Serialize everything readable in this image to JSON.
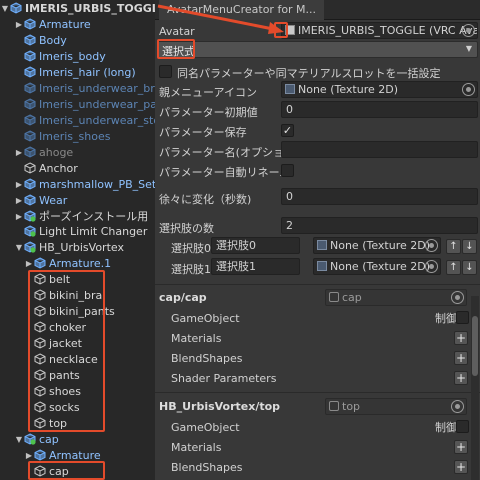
{
  "hierarchy": {
    "items": [
      {
        "label": "IMERIS_URBIS_TOGGLE",
        "style": "root",
        "arrow": "▼",
        "icon": "prefab",
        "indent": 0
      },
      {
        "label": "Armature",
        "style": "pf",
        "arrow": "▶",
        "icon": "prefab",
        "indent": 1
      },
      {
        "label": "Body",
        "style": "pf",
        "arrow": "",
        "icon": "prefab",
        "indent": 1
      },
      {
        "label": "Imeris_body",
        "style": "pf",
        "arrow": "",
        "icon": "prefab",
        "indent": 1
      },
      {
        "label": "Imeris_hair (long)",
        "style": "pf",
        "arrow": "",
        "icon": "prefab",
        "indent": 1
      },
      {
        "label": "Imeris_underwear_bra",
        "style": "pfdim",
        "arrow": "",
        "icon": "prefab-dim",
        "indent": 1
      },
      {
        "label": "Imeris_underwear_panty",
        "style": "pfdim",
        "arrow": "",
        "icon": "prefab-dim",
        "indent": 1
      },
      {
        "label": "Imeris_underwear_stocking",
        "style": "pfdim",
        "arrow": "",
        "icon": "prefab-dim",
        "indent": 1
      },
      {
        "label": "Imeris_shoes",
        "style": "pfdim",
        "arrow": "",
        "icon": "prefab-dim",
        "indent": 1
      },
      {
        "label": "ahoge",
        "style": "dim",
        "arrow": "▶",
        "icon": "prefab-dim",
        "indent": 1
      },
      {
        "label": "Anchor",
        "style": "plain",
        "arrow": "",
        "icon": "object",
        "indent": 1
      },
      {
        "label": "marshmallow_PB_Setup",
        "style": "pf",
        "arrow": "▶",
        "icon": "prefab",
        "indent": 1
      },
      {
        "label": "Wear",
        "style": "pf",
        "arrow": "▶",
        "icon": "prefab",
        "indent": 1
      },
      {
        "label": "ポーズインストール用",
        "style": "plain",
        "arrow": "▶",
        "icon": "prefab-green",
        "indent": 1
      },
      {
        "label": "Light Limit Changer",
        "style": "plain",
        "arrow": "",
        "icon": "prefab-green",
        "indent": 1
      },
      {
        "label": "HB_UrbisVortex",
        "style": "plain",
        "arrow": "▼",
        "icon": "prefab-green",
        "indent": 1
      },
      {
        "label": "Armature.1",
        "style": "pf",
        "arrow": "▶",
        "icon": "prefab",
        "indent": 2
      },
      {
        "label": "belt",
        "style": "plain",
        "arrow": "",
        "icon": "object",
        "indent": 2
      },
      {
        "label": "bikini_bra",
        "style": "plain",
        "arrow": "",
        "icon": "object",
        "indent": 2
      },
      {
        "label": "bikini_pants",
        "style": "plain",
        "arrow": "",
        "icon": "object",
        "indent": 2
      },
      {
        "label": "choker",
        "style": "plain",
        "arrow": "",
        "icon": "object",
        "indent": 2
      },
      {
        "label": "jacket",
        "style": "plain",
        "arrow": "",
        "icon": "object",
        "indent": 2
      },
      {
        "label": "necklace",
        "style": "plain",
        "arrow": "",
        "icon": "object",
        "indent": 2
      },
      {
        "label": "pants",
        "style": "plain",
        "arrow": "",
        "icon": "object",
        "indent": 2
      },
      {
        "label": "shoes",
        "style": "plain",
        "arrow": "",
        "icon": "object",
        "indent": 2
      },
      {
        "label": "socks",
        "style": "plain",
        "arrow": "",
        "icon": "object",
        "indent": 2
      },
      {
        "label": "top",
        "style": "plain",
        "arrow": "",
        "icon": "object",
        "indent": 2
      },
      {
        "label": "cap",
        "style": "pf",
        "arrow": "▼",
        "icon": "prefab-green",
        "indent": 1
      },
      {
        "label": "Armature",
        "style": "pf",
        "arrow": "▶",
        "icon": "prefab",
        "indent": 2
      },
      {
        "label": "cap",
        "style": "plain",
        "arrow": "",
        "icon": "object",
        "indent": 2
      }
    ]
  },
  "inspector": {
    "tab_title": "AvatarMenuCreator for M...",
    "avatar_label": "Avatar",
    "avatar_value": "IMERIS_URBIS_TOGGLE (VRC Avatar D",
    "menu_type": "選択式",
    "sync_checkbox_label": "同名パラメーターや同マテリアルスロットを一括設定",
    "parent_menu_icon_label": "親メニューアイコン",
    "parent_menu_icon_value": "None (Texture 2D)",
    "param_default_label": "パラメーター初期値",
    "param_default_value": "0",
    "param_saved_label": "パラメーター保存",
    "param_saved_check": "✓",
    "param_name_label": "パラメーター名(オプショナル)",
    "param_autorename_label": "パラメーター自動リネーム",
    "gradual_label": "徐々に変化（秒数)",
    "gradual_value": "0",
    "choice_count_label": "選択肢の数",
    "choice_count_value": "2",
    "choices": [
      {
        "label": "選択肢0",
        "value": "選択肢0",
        "icon": "None (Texture 2D)"
      },
      {
        "label": "選択肢1",
        "value": "選択肢1",
        "icon": "None (Texture 2D)"
      }
    ],
    "sections": [
      {
        "title": "cap/cap",
        "ref": "cap",
        "rows": [
          "GameObject",
          "Materials",
          "BlendShapes",
          "Shader Parameters"
        ],
        "control_label": "制御"
      },
      {
        "title": "HB_UrbisVortex/top",
        "ref": "top",
        "rows": [
          "GameObject",
          "Materials",
          "BlendShapes"
        ],
        "control_label": "制御"
      }
    ],
    "plus": "+",
    "up": "↑",
    "down": "↓"
  },
  "colors": {
    "highlight": "#e34b2b",
    "prefab_blue": "#8fc2ff",
    "panel_bg": "#383838",
    "hierarchy_bg": "#282828"
  }
}
